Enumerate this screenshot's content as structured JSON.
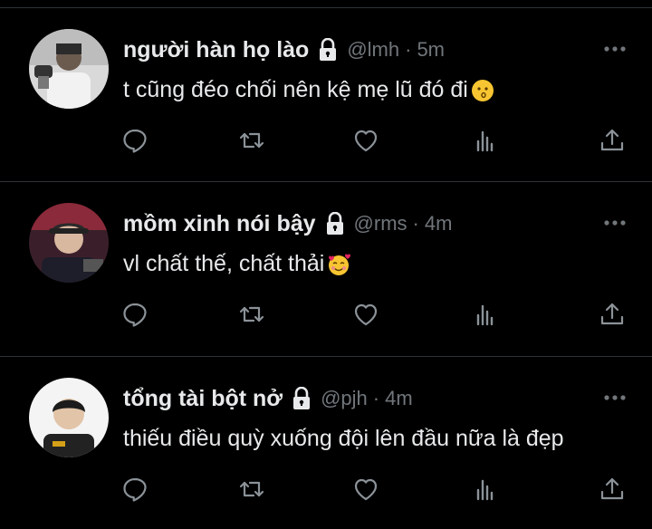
{
  "colors": {
    "background": "#000000",
    "text": "#e7e9ea",
    "muted": "#71767b",
    "divider": "#2f3336"
  },
  "tweets": [
    {
      "name": "người hàn họ lào",
      "handle": "@lmh",
      "separator": "·",
      "time": "5m",
      "text": "t cũng đéo chối nên kệ mẹ lũ đó đi",
      "emoji": "kissing-face-emoji"
    },
    {
      "name": "mồm xinh nói bậy",
      "handle": "@rms",
      "separator": "·",
      "time": "4m",
      "text": "vl chất thế, chất thải",
      "emoji": "smiling-face-with-hearts-emoji"
    },
    {
      "name": "tổng tài bột nở",
      "handle": "@pjh",
      "separator": "·",
      "time": "4m",
      "text": "thiếu điều quỳ xuống đội lên đầu nữa là đẹp",
      "emoji": ""
    }
  ],
  "icons": {
    "lock": "lock-icon",
    "more": "more-icon",
    "reply": "reply-icon",
    "retweet": "retweet-icon",
    "like": "heart-icon",
    "views": "views-icon",
    "share": "share-icon"
  }
}
